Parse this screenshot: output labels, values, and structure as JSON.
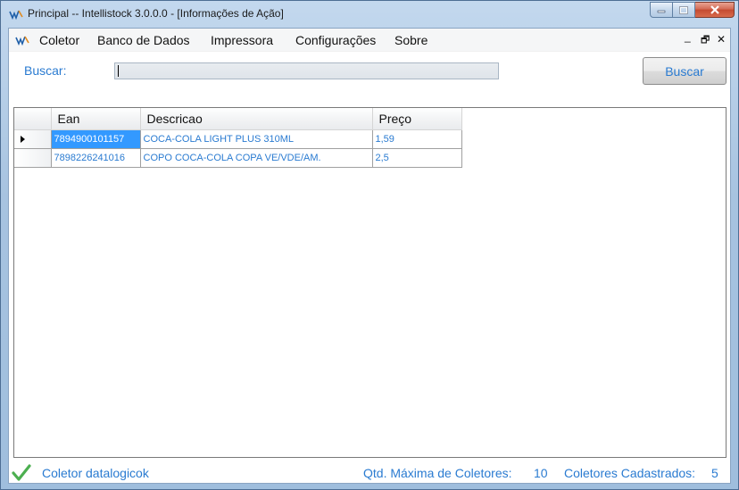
{
  "window": {
    "title": "Principal -- Intellistock 3.0.0.0 - [Informações de Ação]",
    "controls": [
      "minimize-icon",
      "maximize-icon",
      "close-icon"
    ]
  },
  "menu": {
    "items": [
      {
        "label": "Coletor"
      },
      {
        "label": "Banco de Dados"
      },
      {
        "label": "Impressora"
      },
      {
        "label": "Configurações"
      },
      {
        "label": "Sobre"
      }
    ],
    "mdi_minimize": "_",
    "mdi_restore": "🗗",
    "mdi_close": "✕"
  },
  "search": {
    "label": "Buscar:",
    "value": "",
    "button_label": "Buscar"
  },
  "grid": {
    "columns": [
      "Ean",
      "Descricao",
      "Preço"
    ],
    "rows": [
      {
        "ean": "7894900101157",
        "descricao": "COCA-COLA LIGHT PLUS 310ML",
        "preco": "1,59"
      },
      {
        "ean": "7898226241016",
        "descricao": "COPO COCA-COLA COPA VE/VDE/AM.",
        "preco": "2,5"
      }
    ]
  },
  "status": {
    "message": "Coletor datalogicok",
    "max_label": "Qtd. Máxima de Coletores:",
    "max_value": "10",
    "registered_label": "Coletores Cadastrados:",
    "registered_value": "5"
  },
  "colors": {
    "accent_text": "#2a7bd1",
    "selection": "#3399ff",
    "status_ok": "#4caf50"
  }
}
